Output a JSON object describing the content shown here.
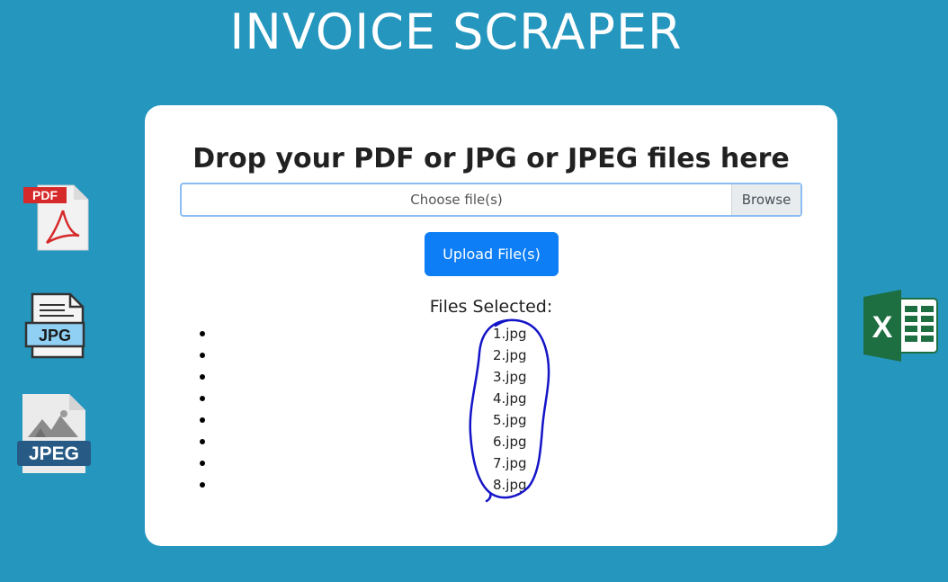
{
  "app": {
    "title": "INVOICE SCRAPER"
  },
  "upload_card": {
    "heading": "Drop your PDF or JPG or JPEG files here",
    "file_input_label": "Choose file(s)",
    "browse_label": "Browse",
    "upload_button_label": "Upload File(s)",
    "files_heading": "Files Selected:",
    "files": [
      "1.jpg",
      "2.jpg",
      "3.jpg",
      "4.jpg",
      "5.jpg",
      "6.jpg",
      "7.jpg",
      "8.jpg"
    ]
  },
  "decorations": {
    "left_icons": [
      {
        "icon": "pdf-file-icon",
        "label": "PDF"
      },
      {
        "icon": "jpg-file-icon",
        "label": "JPG"
      },
      {
        "icon": "jpeg-file-icon",
        "label": "JPEG"
      }
    ],
    "right_icon": {
      "icon": "excel-icon",
      "label": "X"
    }
  },
  "colors": {
    "background": "#2596be",
    "card": "#ffffff",
    "primary_button": "#0d7ef5",
    "annotation": "#1414c8",
    "excel_green": "#1d6f42"
  }
}
